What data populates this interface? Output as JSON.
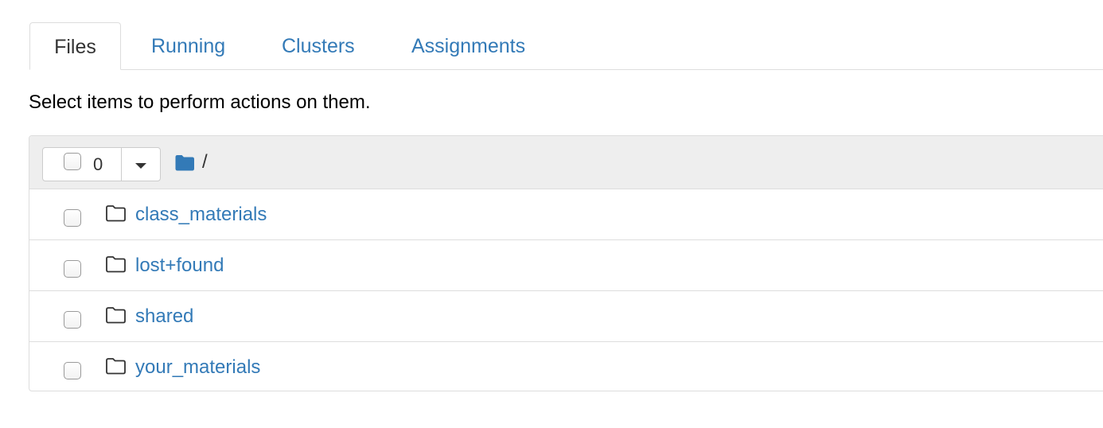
{
  "tabs": [
    {
      "label": "Files",
      "active": true
    },
    {
      "label": "Running",
      "active": false
    },
    {
      "label": "Clusters",
      "active": false
    },
    {
      "label": "Assignments",
      "active": false
    }
  ],
  "instruction": "Select items to perform actions on them.",
  "toolbar": {
    "selected_count": "0",
    "breadcrumb_root": "/"
  },
  "files": [
    {
      "name": "class_materials",
      "type": "folder",
      "icon": "folder-outline-icon"
    },
    {
      "name": "lost+found",
      "type": "folder",
      "icon": "folder-outline-icon"
    },
    {
      "name": "shared",
      "type": "folder",
      "icon": "folder-outline-icon"
    },
    {
      "name": "your_materials",
      "type": "folder",
      "icon": "folder-outline-icon"
    }
  ],
  "colors": {
    "link": "#337ab7",
    "header_bg": "#eeeeee",
    "border": "#dddddd",
    "breadcrumb_folder": "#337ab7"
  }
}
